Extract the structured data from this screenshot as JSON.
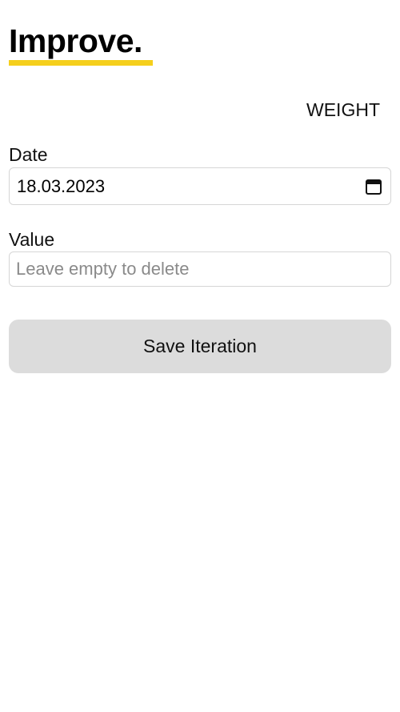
{
  "header": {
    "logo_text": "Improve.",
    "accent_color": "#f5cf1c"
  },
  "category": {
    "label": "WEIGHT"
  },
  "form": {
    "date_label": "Date",
    "date_value": "18.03.2023",
    "date_icon": "calendar-icon",
    "value_label": "Value",
    "value_value": "",
    "value_placeholder": "Leave empty to delete",
    "save_label": "Save Iteration"
  }
}
